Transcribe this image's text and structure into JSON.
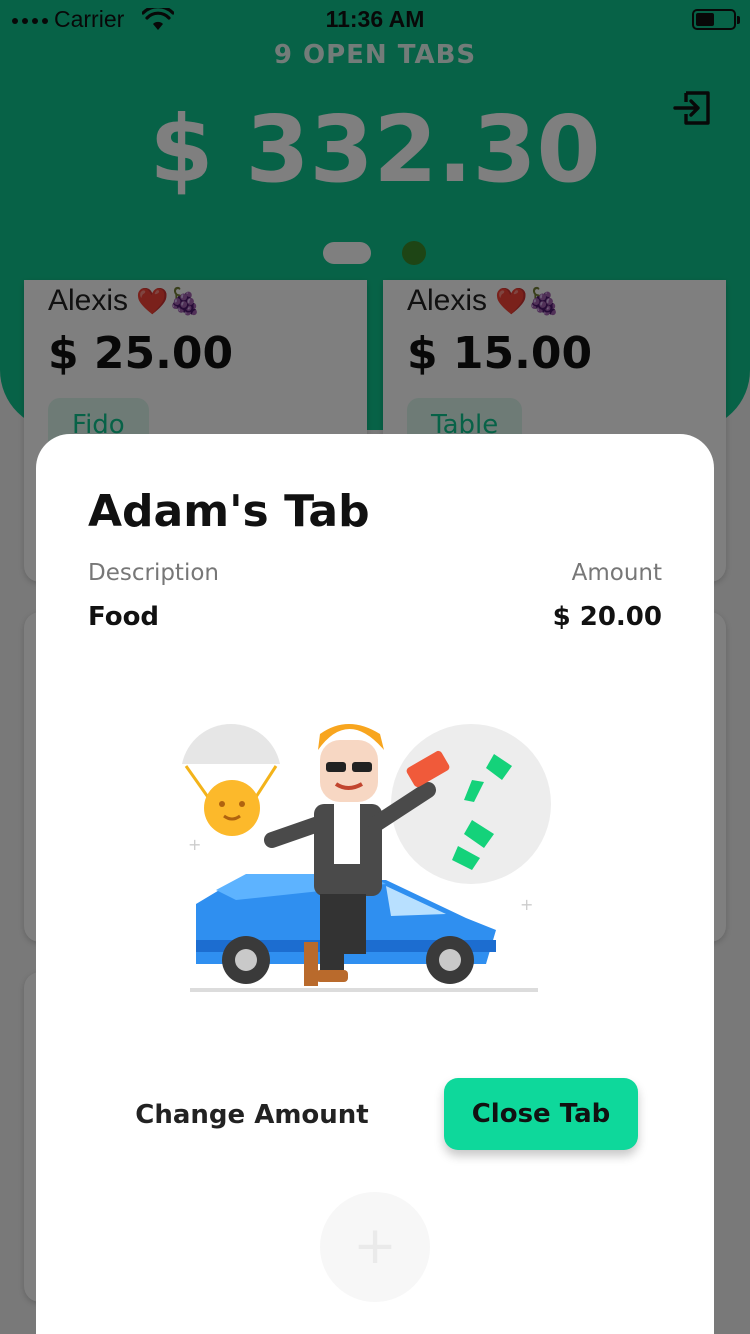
{
  "status_bar": {
    "carrier": "Carrier",
    "time": "11:36 AM"
  },
  "header": {
    "open_tabs": "9 OPEN TABS",
    "total": "$ 332.30"
  },
  "cards": [
    {
      "name": "Alexis",
      "amount": "$ 25.00",
      "tag": "Fido"
    },
    {
      "name": "Alexis",
      "amount": "$ 15.00",
      "tag": "Table"
    }
  ],
  "modal": {
    "title": "Adam's Tab",
    "col_description": "Description",
    "col_amount": "Amount",
    "items": [
      {
        "description": "Food",
        "amount": "$ 20.00"
      }
    ],
    "change_amount_label": "Change Amount",
    "close_tab_label": "Close Tab"
  },
  "colors": {
    "brand": "#0fc58e",
    "button": "#0ed89b"
  },
  "icons": {
    "logout": "logout-icon",
    "wifi": "wifi-icon",
    "battery": "battery-icon",
    "add": "plus-icon"
  }
}
